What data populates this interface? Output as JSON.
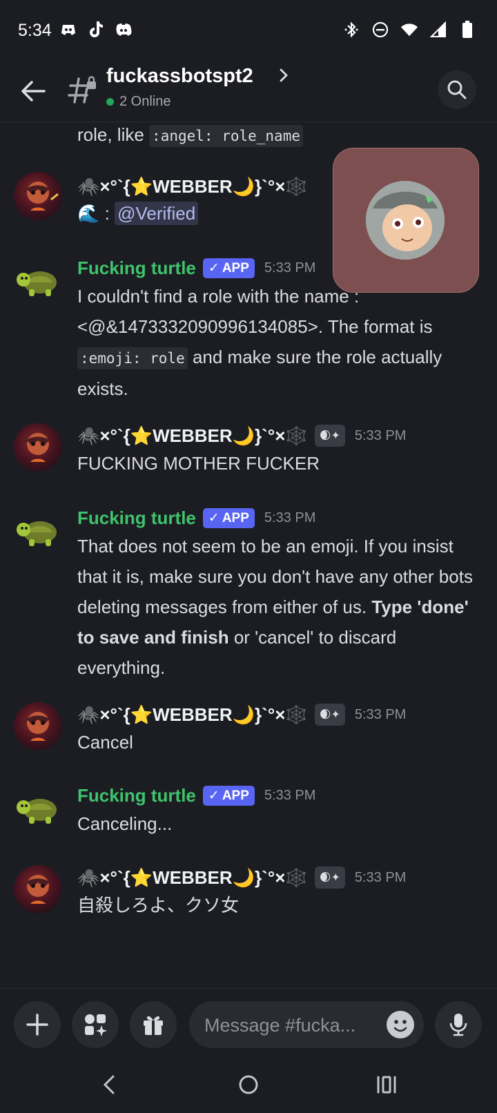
{
  "status_bar": {
    "time": "5:34",
    "app_icons": [
      "discord-app-icon",
      "tiktok-icon",
      "discord-icon"
    ],
    "system_icons": [
      "bluetooth-icon",
      "dnd-icon",
      "wifi-icon",
      "signal-icon",
      "battery-icon"
    ]
  },
  "header": {
    "channel_name": "fuckassbotspt2",
    "online": "2 Online"
  },
  "messages": [
    {
      "kind": "continuation",
      "text_prefix": "role, like ",
      "code": ":angel: role_name"
    },
    {
      "kind": "user",
      "author": "🕷️×°`{⭐WEBBER🌙}`°×🕸️",
      "emoji": "🌊",
      "separator": ":",
      "mention": "@Verified"
    },
    {
      "kind": "bot",
      "author": "Fucking turtle",
      "tag": "APP",
      "timestamp": "5:33 PM",
      "text_a": "I couldn't find a role with the name : <@&1473332090996134085>. The format is ",
      "code": ":emoji: role",
      "text_b": " and make sure the role actually exists."
    },
    {
      "kind": "user",
      "author": "🕷️×°`{⭐WEBBER🌙}`°×🕸️",
      "badge": "🌒✦",
      "timestamp": "5:33 PM",
      "text": "FUCKING MOTHER FUCKER"
    },
    {
      "kind": "bot",
      "author": "Fucking turtle",
      "tag": "APP",
      "timestamp": "5:33 PM",
      "text_a": "That does not seem to be an emoji. If you insist that it is, make sure you don't have any other bots deleting messages from either of us. ",
      "bold": "Type 'done' to save and finish",
      "text_b": " or 'cancel' to discard everything."
    },
    {
      "kind": "user",
      "author": "🕷️×°`{⭐WEBBER🌙}`°×🕸️",
      "badge": "🌒✦",
      "timestamp": "5:33 PM",
      "text": "Cancel"
    },
    {
      "kind": "bot",
      "author": "Fucking turtle",
      "tag": "APP",
      "timestamp": "5:33 PM",
      "text": "Canceling..."
    },
    {
      "kind": "user",
      "author": "🕷️×°`{⭐WEBBER🌙}`°×🕸️",
      "badge": "🌒✦",
      "timestamp": "5:33 PM",
      "text": "自殺しろよ、クソ女"
    }
  ],
  "composer": {
    "placeholder": "Message #fucka..."
  },
  "colors": {
    "background": "#1c1d22",
    "bot_name": "#3fc46d",
    "app_tag": "#5865f2",
    "online_dot": "#23a55a",
    "pip_background": "#7e4f50"
  }
}
